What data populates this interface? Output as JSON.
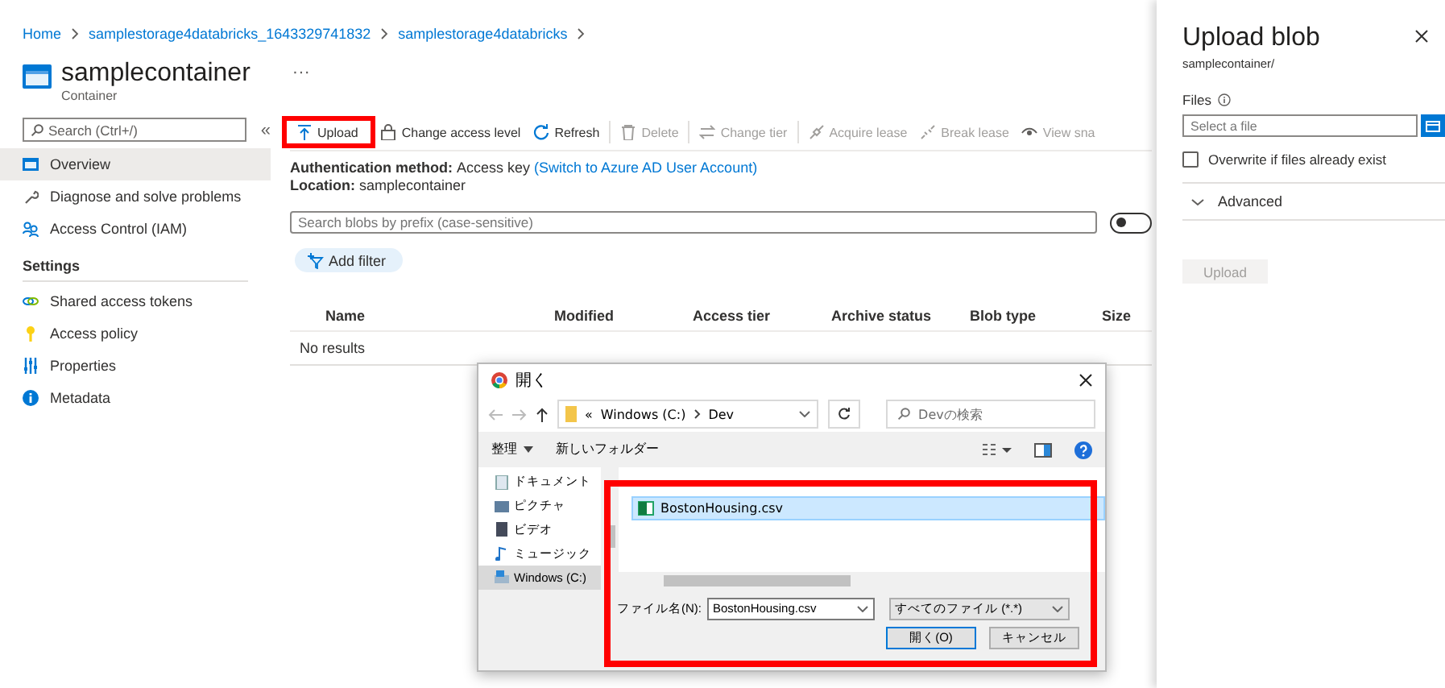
{
  "breadcrumb": [
    {
      "label": "Home"
    },
    {
      "label": "samplestorage4databricks_1643329741832"
    },
    {
      "label": "samplestorage4databricks"
    }
  ],
  "header": {
    "title": "samplecontainer",
    "subtitle": "Container",
    "more": "···"
  },
  "sidebar": {
    "search_placeholder": "Search (Ctrl+/)",
    "collapse": "«",
    "items": [
      {
        "kind": "item",
        "label": "Overview",
        "selected": true
      },
      {
        "kind": "item",
        "label": "Diagnose and solve problems",
        "selected": false
      },
      {
        "kind": "item",
        "label": "Access Control (IAM)",
        "selected": false
      },
      {
        "kind": "heading",
        "label": "Settings"
      },
      {
        "kind": "item",
        "label": "Shared access tokens",
        "selected": false
      },
      {
        "kind": "item",
        "label": "Access policy",
        "selected": false
      },
      {
        "kind": "item",
        "label": "Properties",
        "selected": false
      },
      {
        "kind": "item",
        "label": "Metadata",
        "selected": false
      }
    ]
  },
  "toolbar": [
    {
      "label": "Upload",
      "disabled": false,
      "highlighted": true
    },
    {
      "label": "Change access level",
      "disabled": false,
      "highlighted": false
    },
    {
      "label": "Refresh",
      "disabled": false,
      "highlighted": false
    },
    {
      "label": "Delete",
      "disabled": true,
      "highlighted": false
    },
    {
      "label": "Change tier",
      "disabled": true,
      "highlighted": false
    },
    {
      "label": "Acquire lease",
      "disabled": true,
      "highlighted": false
    },
    {
      "label": "Break lease",
      "disabled": true,
      "highlighted": false
    },
    {
      "label": "View sna",
      "disabled": true,
      "highlighted": false
    }
  ],
  "info": {
    "auth_label": "Authentication method:",
    "auth_value": "Access key",
    "auth_link": "(Switch to Azure AD User Account)",
    "location_label": "Location:",
    "location_value": "samplecontainer"
  },
  "blob_search": {
    "placeholder": "Search blobs by prefix (case-sensitive)",
    "toggle_on": false
  },
  "add_filter": "Add filter",
  "table": {
    "columns": [
      "Name",
      "Modified",
      "Access tier",
      "Archive status",
      "Blob type",
      "Size"
    ],
    "empty": "No results"
  },
  "dialog": {
    "title": "開く",
    "path_prefix": "«",
    "path": [
      "Windows (C:)",
      "Dev"
    ],
    "search_placeholder": "Devの検索",
    "organize": "整理",
    "new_folder": "新しいフォルダー",
    "nav": [
      {
        "label": "ドキュメント",
        "selected": false
      },
      {
        "label": "ピクチャ",
        "selected": false
      },
      {
        "label": "ビデオ",
        "selected": false
      },
      {
        "label": "ミュージック",
        "selected": false
      },
      {
        "label": "Windows (C:)",
        "selected": true
      }
    ],
    "files": [
      {
        "name": "BostonHousing.csv",
        "selected": true
      }
    ],
    "filename_label": "ファイル名(N):",
    "filename": "BostonHousing.csv",
    "filetype": "すべてのファイル (*.*)",
    "open": "開く(O)",
    "cancel": "キャンセル",
    "highlighted": true
  },
  "panel": {
    "title": "Upload blob",
    "subtitle": "samplecontainer/",
    "files_label": "Files",
    "file_placeholder": "Select a file",
    "overwrite": {
      "label": "Overwrite if files already exist",
      "checked": false
    },
    "advanced": {
      "label": "Advanced",
      "expanded": false
    },
    "upload": {
      "label": "Upload",
      "disabled": true
    }
  }
}
